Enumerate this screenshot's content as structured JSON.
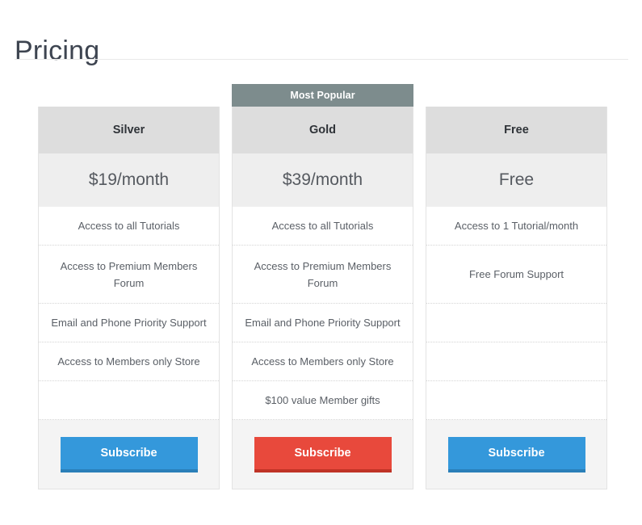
{
  "page": {
    "title": "Pricing"
  },
  "colors": {
    "ribbon": "#7d8c8d",
    "header_bg": "#dddddd",
    "price_bg": "#eeeeee",
    "footer_bg": "#f4f4f4",
    "btn_blue": "#3498db",
    "btn_blue_shadow": "#2a7fb8",
    "btn_red": "#e8493c",
    "btn_red_shadow": "#bf3326",
    "title_text": "#3d4450",
    "feature_text": "#5a5f66"
  },
  "plans": [
    {
      "ribbon": "",
      "name": "Silver",
      "price": "$19/month",
      "features": [
        "Access to all Tutorials",
        "Access to Premium Members Forum",
        "Email and Phone Priority Support",
        "Access to Members only Store",
        ""
      ],
      "button_label": "Subscribe",
      "button_style": "blue"
    },
    {
      "ribbon": "Most Popular",
      "name": "Gold",
      "price": "$39/month",
      "features": [
        "Access to all Tutorials",
        "Access to Premium Members Forum",
        "Email and Phone Priority Support",
        "Access to Members only Store",
        "$100 value Member gifts"
      ],
      "button_label": "Subscribe",
      "button_style": "red"
    },
    {
      "ribbon": "",
      "name": "Free",
      "price": "Free",
      "features": [
        "Access to 1 Tutorial/month",
        "Free Forum Support",
        "",
        "",
        ""
      ],
      "button_label": "Subscribe",
      "button_style": "blue"
    }
  ]
}
